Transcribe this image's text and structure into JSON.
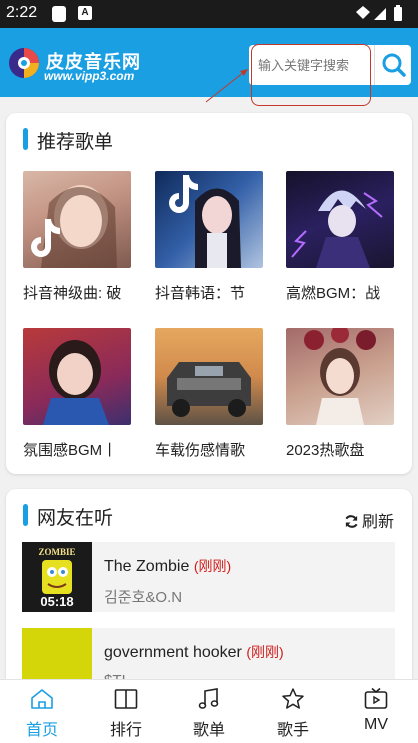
{
  "status_bar": {
    "time": "2:22"
  },
  "header": {
    "brand_name": "皮皮音乐网",
    "brand_url": "www.vipp3.com",
    "search_placeholder": "输入关键字搜索",
    "brand_color": "#1a9fe3"
  },
  "recommended": {
    "title": "推荐歌单",
    "items": [
      {
        "name": "抖音神级曲: 破"
      },
      {
        "name": "抖音韩语：节"
      },
      {
        "name": "高燃BGM：战"
      },
      {
        "name": "氛围感BGM丨"
      },
      {
        "name": "车载伤感情歌"
      },
      {
        "name": "2023热歌盘"
      }
    ]
  },
  "listening": {
    "title": "网友在听",
    "refresh_label": "刷新",
    "songs": [
      {
        "title": "The Zombie",
        "tag": "(刚刚)",
        "artist": "김준호&O.N",
        "duration": "05:18",
        "thumb_caption": "ZOMBIE"
      },
      {
        "title": "government hooker",
        "tag": "(刚刚)",
        "artist": "$TI"
      }
    ]
  },
  "bottom_nav": [
    {
      "label": "首页",
      "icon": "home-icon"
    },
    {
      "label": "排行",
      "icon": "book-icon"
    },
    {
      "label": "歌单",
      "icon": "music-note-icon"
    },
    {
      "label": "歌手",
      "icon": "star-icon"
    },
    {
      "label": "MV",
      "icon": "tv-icon"
    }
  ]
}
